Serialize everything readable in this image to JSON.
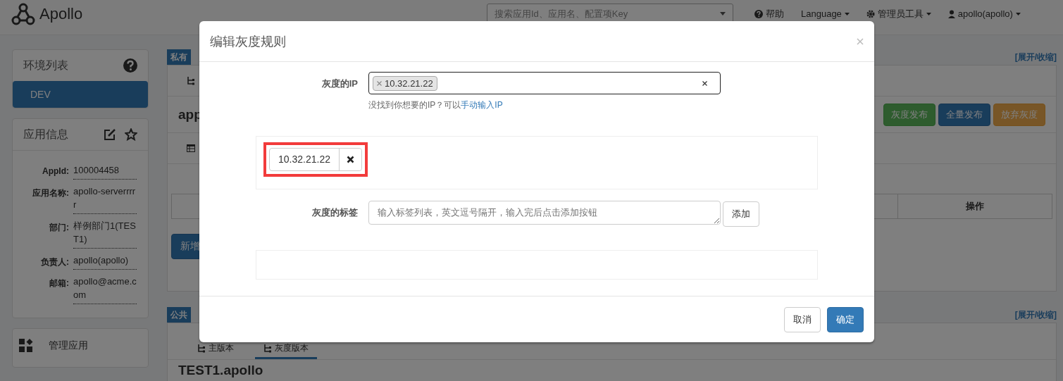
{
  "navbar": {
    "brand": "Apollo",
    "search": {
      "placeholder": "搜索应用Id、应用名、配置项Key"
    },
    "links": [
      {
        "kind": "help",
        "label": "帮助"
      },
      {
        "kind": "language",
        "label": "Language"
      },
      {
        "kind": "admin",
        "label": "管理员工具"
      },
      {
        "kind": "user",
        "label": "apollo(apollo)"
      }
    ]
  },
  "sidebar": {
    "env_panel": {
      "title": "环境列表",
      "items": [
        {
          "label": "DEV",
          "selected": true
        }
      ]
    },
    "app_info": {
      "title": "应用信息",
      "fields": [
        {
          "label": "AppId:",
          "value": "100004458"
        },
        {
          "label": "应用名称:",
          "value": "apollo-serverrrrr"
        },
        {
          "label": "部门:",
          "value": "样例部门1(TEST1)"
        },
        {
          "label": "负责人:",
          "value": "apollo(apollo)"
        },
        {
          "label": "邮箱:",
          "value": "apollo@acme.com"
        }
      ]
    },
    "manage": {
      "label": "管理应用"
    }
  },
  "sections": [
    {
      "badge": "私有",
      "toggle": "[展开/收缩]",
      "title": "app",
      "buttons": [
        {
          "kind": "success",
          "label": "灰度发布"
        },
        {
          "kind": "primary",
          "label": "全量发布"
        },
        {
          "kind": "warning",
          "label": "放弃灰度"
        }
      ],
      "table": {
        "columns": [
          "操作"
        ]
      },
      "add_button": "新增"
    },
    {
      "badge": "公共",
      "toggle": "[展开/收缩]",
      "tabs": [
        {
          "label": "主版本",
          "selected": false
        },
        {
          "label": "灰度版本",
          "selected": true
        }
      ],
      "title": "TEST1.apollo"
    }
  ],
  "modal": {
    "title": "编辑灰度规则",
    "ip_field": {
      "label": "灰度的IP",
      "tags": [
        "10.32.21.22"
      ],
      "help": "没找到你想要的IP？可以",
      "help_link": "手动输入IP"
    },
    "ip_list": [
      {
        "ip": "10.32.21.22",
        "highlighted": true
      }
    ],
    "label_field": {
      "label": "灰度的标签",
      "placeholder": "输入标签列表，英文逗号隔开，输入完后点击添加按钮",
      "add_button": "添加"
    },
    "buttons": [
      {
        "kind": "default",
        "label": "取消"
      },
      {
        "kind": "primary",
        "label": "确定"
      }
    ]
  }
}
